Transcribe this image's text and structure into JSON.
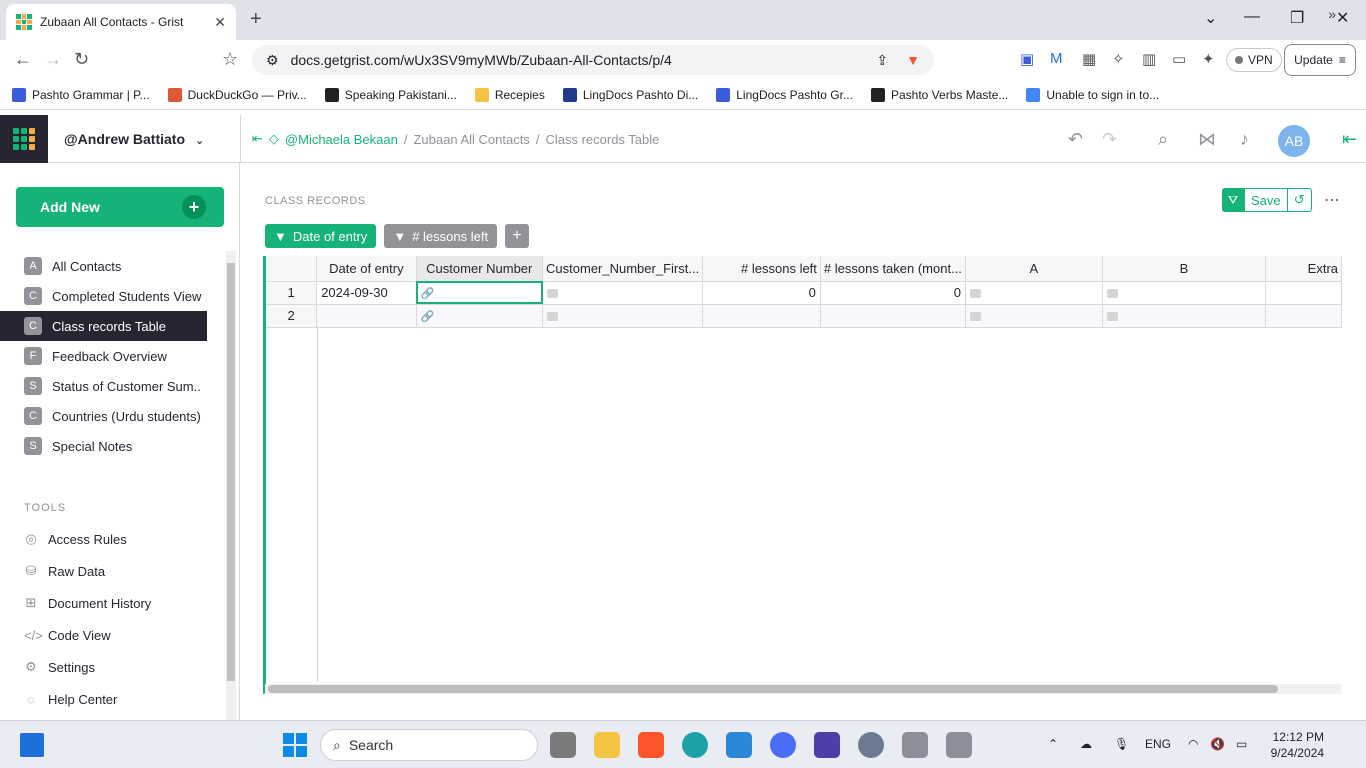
{
  "browser": {
    "tab_title": "Zubaan All Contacts - Grist",
    "url": "docs.getgrist.com/wUx3SV9myMWb/Zubaan-All-Contacts/p/4",
    "vpn_label": "VPN",
    "update_label": "Update",
    "bookmarks": [
      {
        "label": "Pashto Grammar | P...",
        "color": "#3b5bdb"
      },
      {
        "label": "DuckDuckGo — Priv...",
        "color": "#de5833"
      },
      {
        "label": "Speaking Pakistani...",
        "color": "#222222"
      },
      {
        "label": "Recepies",
        "color": "#f4c542"
      },
      {
        "label": "LingDocs Pashto Di...",
        "color": "#1e3a8a"
      },
      {
        "label": "LingDocs Pashto Gr...",
        "color": "#3b5bdb"
      },
      {
        "label": "Pashto Verbs Maste...",
        "color": "#222222"
      },
      {
        "label": "Unable to sign in to...",
        "color": "#4285f4"
      }
    ]
  },
  "app": {
    "user": "@Andrew Battiato",
    "breadcrumb": {
      "workspace": "@Michaela Bekaan",
      "doc": "Zubaan All Contacts",
      "page": "Class records Table"
    },
    "avatar_initials": "AB",
    "add_new_label": "Add New",
    "pages": [
      {
        "icon": "A",
        "label": "All Contacts",
        "active": false
      },
      {
        "icon": "C",
        "label": "Completed Students View",
        "active": false
      },
      {
        "icon": "C",
        "label": "Class records Table",
        "active": true
      },
      {
        "icon": "F",
        "label": "Feedback Overview",
        "active": false
      },
      {
        "icon": "S",
        "label": "Status of Customer Sum...",
        "active": false
      },
      {
        "icon": "C",
        "label": "Countries (Urdu students)",
        "active": false
      },
      {
        "icon": "S",
        "label": "Special Notes",
        "active": false
      }
    ],
    "tools_heading": "TOOLS",
    "tools": [
      {
        "icon": "access-rules-icon",
        "label": "Access Rules"
      },
      {
        "icon": "raw-data-icon",
        "label": "Raw Data"
      },
      {
        "icon": "document-history-icon",
        "label": "Document History"
      },
      {
        "icon": "code-view-icon",
        "label": "Code View"
      },
      {
        "icon": "settings-icon",
        "label": "Settings"
      },
      {
        "icon": "help-center-icon",
        "label": "Help Center"
      }
    ]
  },
  "section": {
    "title": "CLASS RECORDS",
    "save_label": "Save",
    "filters": [
      "Date of entry",
      "# lessons left"
    ],
    "columns": [
      "Date of entry",
      "Customer Number",
      "Customer_Number_First...",
      "# lessons left",
      "# lessons taken (mont...",
      "A",
      "B",
      "Extra"
    ],
    "rows": [
      {
        "n": "1",
        "date": "2024-09-30",
        "lessons_left": "0",
        "lessons_taken": "0"
      },
      {
        "n": "2",
        "date": "",
        "lessons_left": "",
        "lessons_taken": ""
      }
    ]
  },
  "taskbar": {
    "search_placeholder": "Search",
    "lang": "ENG",
    "time": "12:12 PM",
    "date": "9/24/2024"
  },
  "colors": {
    "accent": "#16b378",
    "dark": "#262633",
    "muted": "#929299"
  }
}
